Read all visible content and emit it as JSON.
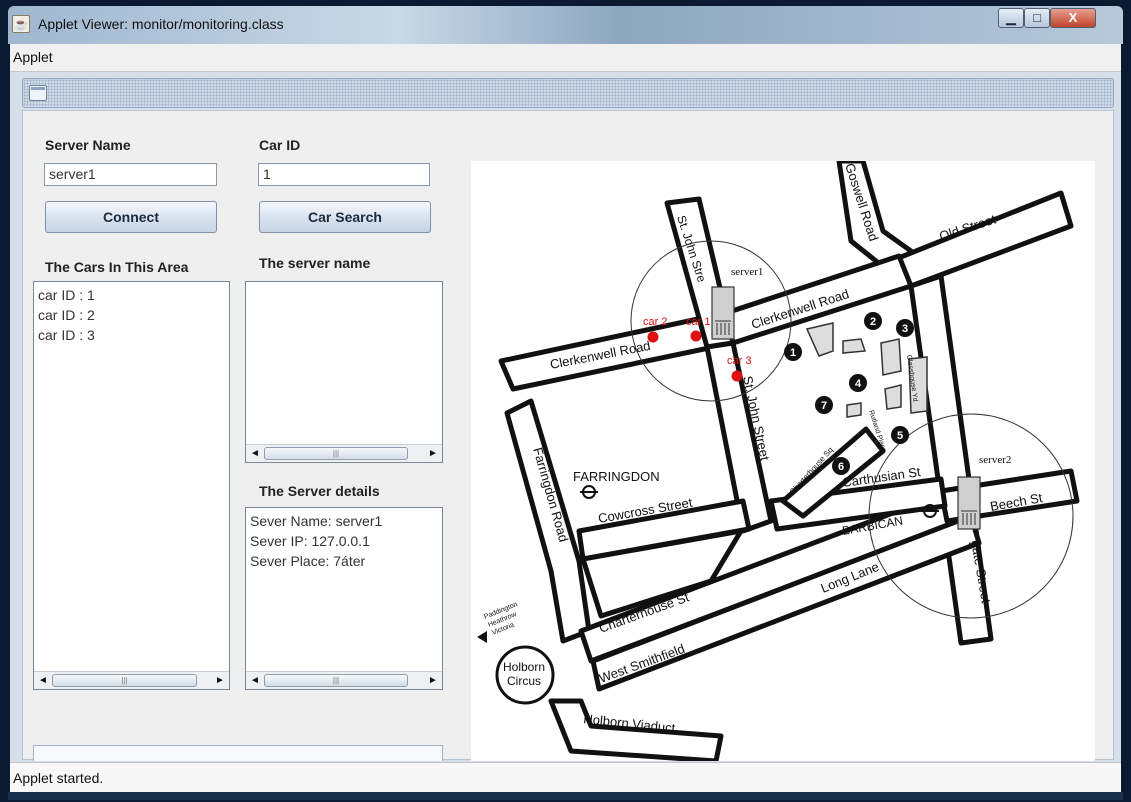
{
  "window": {
    "title": "Applet Viewer: monitor/monitoring.class",
    "app_icon": "java-cup-icon",
    "minimize_glyph": "▁",
    "maximize_glyph": "□",
    "close_glyph": "X"
  },
  "menu": {
    "items": [
      "Applet"
    ]
  },
  "form": {
    "server_name_label": "Server Name",
    "server_name_value": "server1",
    "car_id_label": "Car ID",
    "car_id_value": "1",
    "connect_label": "Connect",
    "car_search_label": "Car Search"
  },
  "lists": {
    "cars_heading": "The Cars In This Area",
    "cars": [
      "car ID : 1",
      "car ID : 2",
      "car ID : 3"
    ],
    "server_name_heading": "The server name",
    "server_details_heading": "The Server details",
    "server_details": [
      "Sever Name: server1",
      "Sever IP: 127.0.0.1",
      "Sever Place: 7áter"
    ]
  },
  "scrollbar": {
    "left_arrow": "◄",
    "right_arrow": "►",
    "grip": "|||"
  },
  "map": {
    "servers": [
      {
        "name": "server1"
      },
      {
        "name": "server2"
      }
    ],
    "cars": [
      "car 2",
      "car 1",
      "car 3"
    ],
    "streets": {
      "goswell": "Goswell Road",
      "old": "Old Street",
      "stjohn_top": "St. John Stre",
      "clerkenwell_right": "Clerkenwell Road",
      "clerkenwell_left": "Clerkenwell Road",
      "stjohn_bottom": "St. John Street",
      "farringdon_station": "FARRINGDON",
      "farringdon_road": "Farringdon Road",
      "cowcross": "Cowcross Street",
      "charterhouse_st": "Charterhouse St",
      "charterhouse_sq": "Charterhouse Sq",
      "carthusian": "Carthusian St",
      "barbican": "BARBICAN",
      "beech": "Beech St",
      "long_lane": "Long Lane",
      "aldersgate": "gate Street",
      "west_smithfield": "West Smithfield",
      "holborn_circus_1": "Holborn",
      "holborn_circus_2": "Circus",
      "holborn_viaduct": "Holborn Viaduct",
      "glasshouse": "Glasshouse Yd",
      "rutland": "Rutland Place",
      "dir_1": "Paddington",
      "dir_2": "Heathrow",
      "dir_3": "Victoria"
    },
    "markers": [
      "1",
      "2",
      "3",
      "4",
      "5",
      "6",
      "7"
    ],
    "colors": {
      "car": "#e01010",
      "road": "#111111",
      "circle": "#333333"
    }
  },
  "status": {
    "text": "Applet started."
  }
}
